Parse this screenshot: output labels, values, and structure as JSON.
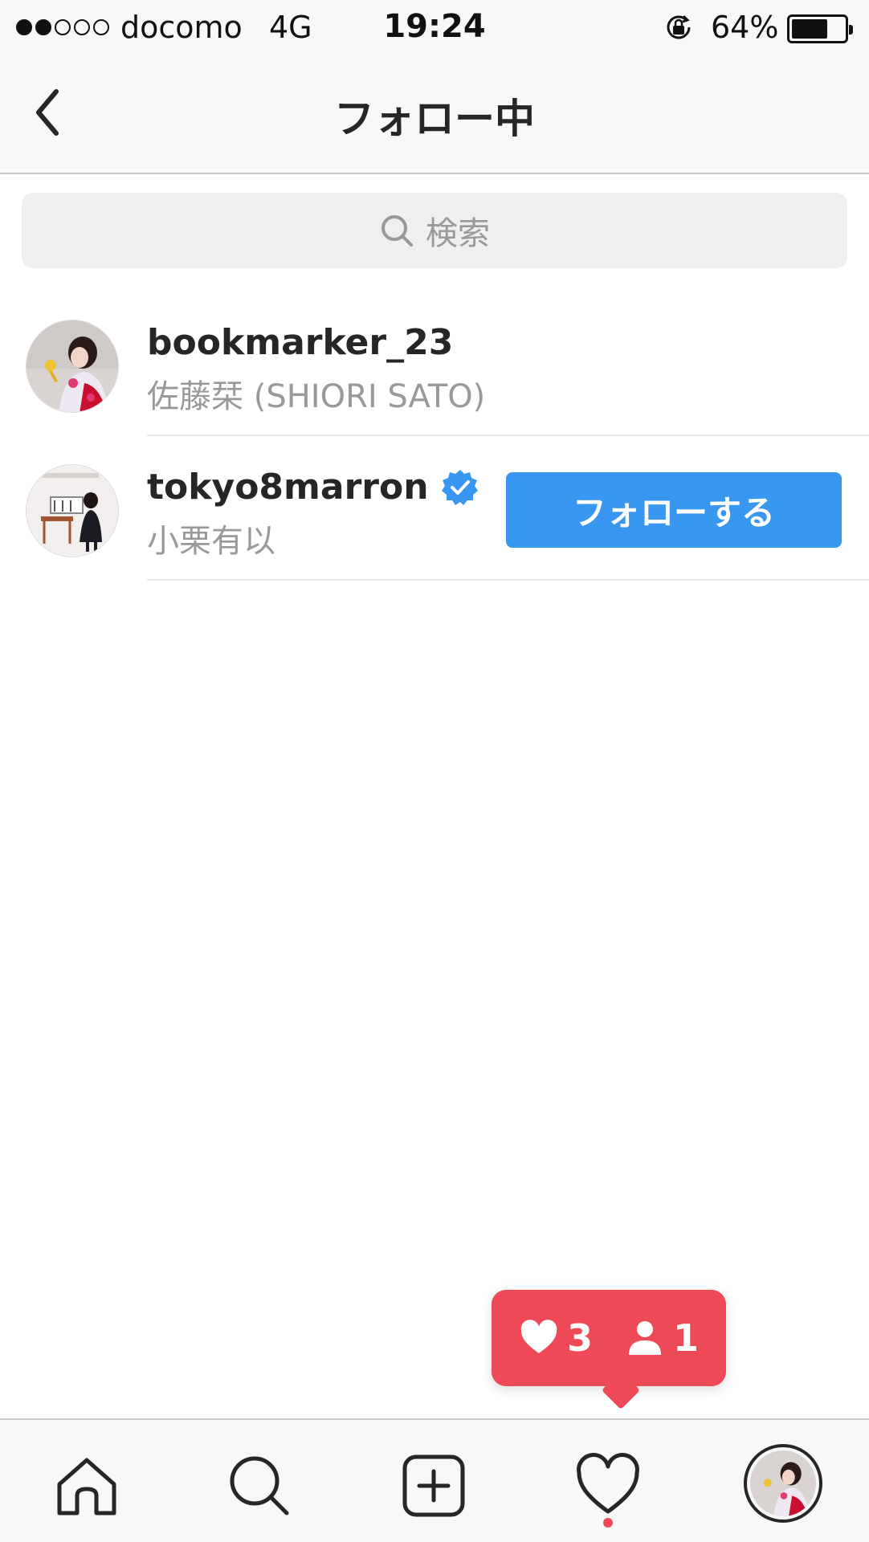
{
  "status_bar": {
    "carrier": "docomo",
    "network": "4G",
    "time": "19:24",
    "battery_percent": "64%",
    "battery_level": 0.64,
    "signal_bars_filled": 2,
    "signal_bars_total": 5
  },
  "nav": {
    "title": "フォロー中",
    "back_icon": "chevron-left-icon"
  },
  "search": {
    "placeholder": "検索",
    "icon": "search-icon"
  },
  "users": [
    {
      "username": "bookmarker_23",
      "full_name": "佐藤栞 (SHIORI SATO)",
      "verified": false,
      "button": ""
    },
    {
      "username": "tokyo8marron",
      "full_name": "小栗有以",
      "verified": true,
      "button": "フォローする"
    }
  ],
  "notification": {
    "likes": "3",
    "follows": "1"
  },
  "tab_bar": {
    "items": [
      "home-icon",
      "search-icon",
      "add-post-icon",
      "heart-icon",
      "profile-avatar"
    ],
    "active_dot": true
  },
  "colors": {
    "accent_blue": "#3897f0",
    "notification_red": "#ed4956",
    "text_primary": "#262626",
    "text_secondary": "#999999",
    "bar_background": "#f8f8f8"
  }
}
